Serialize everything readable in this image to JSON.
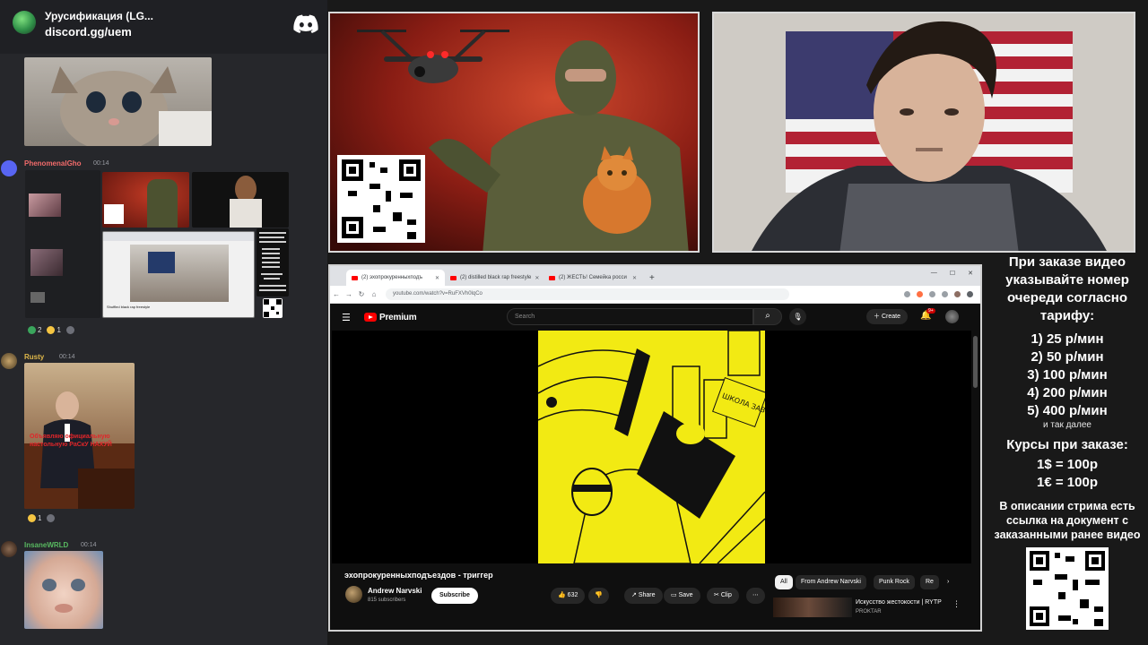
{
  "discord": {
    "server_name": "Урусификация (LG...",
    "invite": "discord.gg/uem",
    "messages": [
      {
        "user": "PhenomenalGho",
        "time": "00:14",
        "color": "#f26b6b"
      },
      {
        "user": "Rusty",
        "time": "00:14",
        "color": "#e0b84a"
      },
      {
        "user": "InsaneWRLD",
        "time": "00:14",
        "color": "#58b960"
      }
    ],
    "reactions_1": [
      {
        "count": "2"
      },
      {
        "count": "1"
      }
    ],
    "reactions_2": [
      {
        "count": "1"
      }
    ],
    "mini_browser": {
      "caption": "Shuffled black rap freestyle"
    },
    "meme_caption": "Объявляю официальную настольную РаСкУ НАХУЙ"
  },
  "browser": {
    "tabs": [
      {
        "label": "(2) эхопрокуренныхподъ",
        "active": true
      },
      {
        "label": "(2) distilled black rap freestyle",
        "active": false
      },
      {
        "label": "(2) ЖЕСТЬ! Семейка росси",
        "active": false
      }
    ],
    "url": "youtube.com/watch?v=RuFXVh0lqCo"
  },
  "youtube": {
    "brand": "Premium",
    "search_placeholder": "Search",
    "create_label": "Create",
    "notification_count": "9+",
    "video_title": "эхопрокуренныхподъездов - триггер",
    "channel_name": "Andrew Narvski",
    "channel_subs": "815 subscribers",
    "subscribe_label": "Subscribe",
    "likes": "632",
    "share_label": "Share",
    "save_label": "Save",
    "clip_label": "Clip",
    "chips": [
      "All",
      "From Andrew Narvski",
      "Punk Rock",
      "Re"
    ],
    "recommended": {
      "title": "Искусство жестокости | RYTP",
      "channel": "PROKTAR"
    },
    "poster_text": "ШКОЛА ЗАВОД"
  },
  "info_panel": {
    "heading": "При заказе видео указывайте номер очереди согласно тарифу:",
    "rates": [
      "1) 25 р/мин",
      "2) 50 р/мин",
      "3) 100 р/мин",
      "4) 200 р/мин",
      "5) 400 р/мин"
    ],
    "rates_note": "и так далее",
    "courses_heading": "Курсы при заказе:",
    "courses": [
      "1$ = 100р",
      "1€ = 100р"
    ],
    "footer": "В описании стрима есть ссылка на документ с заказанными ранее видео"
  },
  "colors": {
    "poster_red": "#a3241a",
    "youtube_red": "#ff0000",
    "poster_yellow": "#f2ea13",
    "chat_bg": "#26272b"
  }
}
